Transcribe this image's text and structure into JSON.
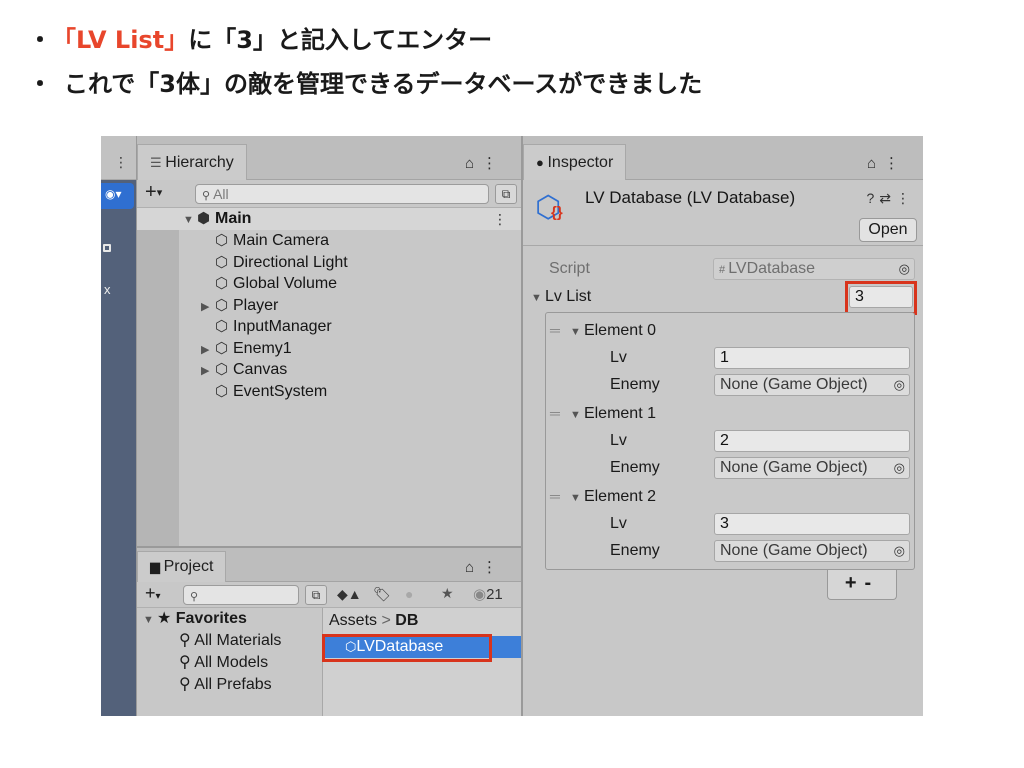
{
  "bullets": [
    {
      "dot": "・",
      "hl": "「LV List」",
      "rest": "に「3」と記入してエンター"
    },
    {
      "dot": "・",
      "hl": "",
      "rest": "これで「3体」の敵を管理できるデータベースができました"
    }
  ],
  "hierarchy": {
    "tab_label": "Hierarchy",
    "search_placeholder": "All",
    "root": "Main",
    "items": [
      {
        "label": "Main Camera",
        "expandable": false
      },
      {
        "label": "Directional Light",
        "expandable": false
      },
      {
        "label": "Global Volume",
        "expandable": false
      },
      {
        "label": "Player",
        "expandable": true
      },
      {
        "label": "InputManager",
        "expandable": false
      },
      {
        "label": "Enemy1",
        "expandable": true
      },
      {
        "label": "Canvas",
        "expandable": true
      },
      {
        "label": "EventSystem",
        "expandable": false
      }
    ]
  },
  "project": {
    "tab_label": "Project",
    "hidden_count": "21",
    "favorites_label": "Favorites",
    "favorites": [
      "All Materials",
      "All Models",
      "All Prefabs"
    ],
    "breadcrumb_root": "Assets",
    "breadcrumb_sep": ">",
    "breadcrumb_leaf": "DB",
    "selected_asset": "LVDatabase"
  },
  "inspector": {
    "tab_label": "Inspector",
    "title": "LV Database (LV Database)",
    "open_button": "Open",
    "script_label": "Script",
    "script_value": "LVDatabase",
    "list_label": "Lv List",
    "list_size": "3",
    "elements": [
      {
        "label": "Element 0",
        "lv_label": "Lv",
        "lv": "1",
        "enemy_label": "Enemy",
        "enemy": "None (Game Object)"
      },
      {
        "label": "Element 1",
        "lv_label": "Lv",
        "lv": "2",
        "enemy_label": "Enemy",
        "enemy": "None (Game Object)"
      },
      {
        "label": "Element 2",
        "lv_label": "Lv",
        "lv": "3",
        "enemy_label": "Enemy",
        "enemy": "None (Game Object)"
      }
    ],
    "add_label": "+",
    "remove_label": "-"
  },
  "colors": {
    "highlight": "#d8341c",
    "selection": "#3d7fd9",
    "text_accent": "#e8462c"
  }
}
